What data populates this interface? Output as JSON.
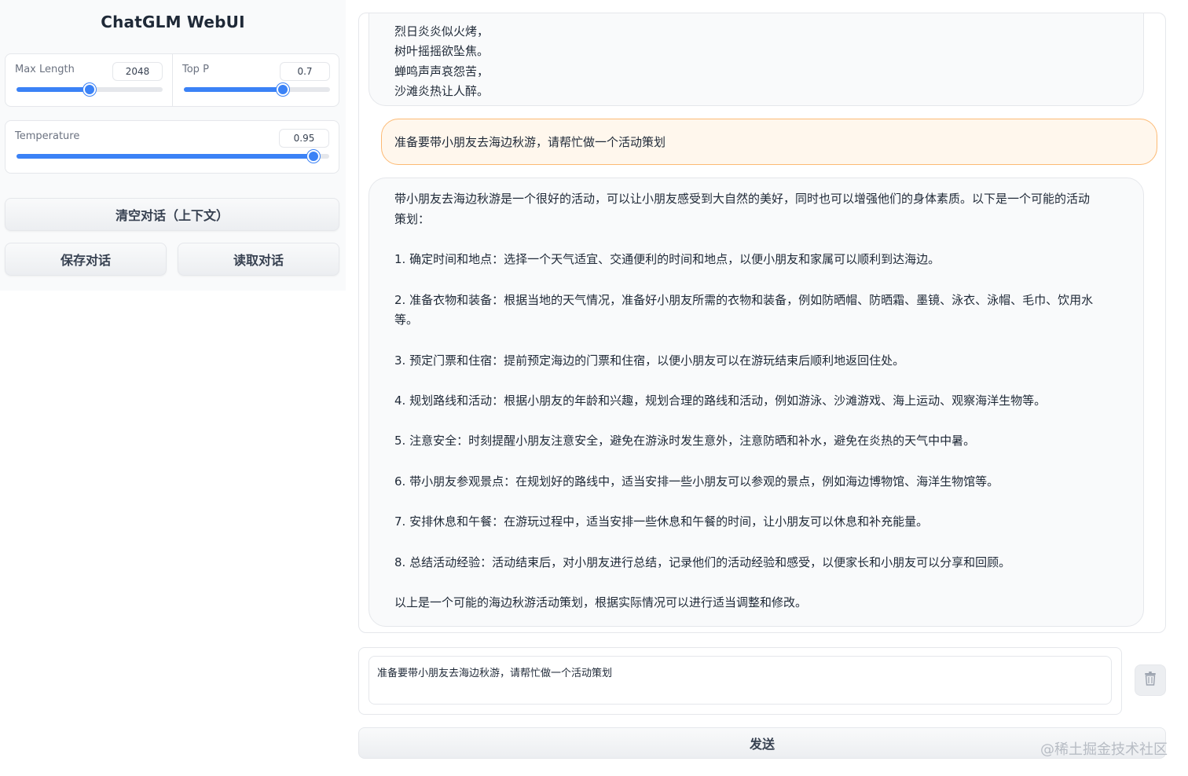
{
  "app": {
    "title": "ChatGLM WebUI"
  },
  "params": {
    "max_length": {
      "label": "Max Length",
      "value": "2048",
      "fraction": 0.5
    },
    "top_p": {
      "label": "Top P",
      "value": "0.7",
      "fraction": 0.68
    },
    "temperature": {
      "label": "Temperature",
      "value": "0.95",
      "fraction": 0.95
    }
  },
  "buttons": {
    "clear": "清空对话（上下文）",
    "save": "保存对话",
    "load": "读取对话",
    "send": "发送"
  },
  "chat": {
    "poem_lines": [
      "烈日炎炎似火烤，",
      "树叶摇摇欲坠焦。",
      "蝉鸣声声哀怨苦，",
      "沙滩炎热让人醉。"
    ],
    "user_message": "准备要带小朋友去海边秋游，请帮忙做一个活动策划",
    "bot_reply": {
      "intro_line1": "带小朋友去海边秋游是一个很好的活动，可以让小朋友感受到大自然的美好，同时也可以增强他们的身体素质。以下是一个可能的活动",
      "intro_line2": "策划：",
      "items": [
        {
          "l1": "1. 确定时间和地点：选择一个天气适宜、交通便利的时间和地点，以便小朋友和家属可以顺利到达海边。",
          "l2": ""
        },
        {
          "l1": "2. 准备衣物和装备：根据当地的天气情况，准备好小朋友所需的衣物和装备，例如防晒帽、防晒霜、墨镜、泳衣、泳帽、毛巾、饮用水",
          "l2": "等。"
        },
        {
          "l1": "3. 预定门票和住宿：提前预定海边的门票和住宿，以便小朋友可以在游玩结束后顺利地返回住处。",
          "l2": ""
        },
        {
          "l1": "4. 规划路线和活动：根据小朋友的年龄和兴趣，规划合理的路线和活动，例如游泳、沙滩游戏、海上运动、观察海洋生物等。",
          "l2": ""
        },
        {
          "l1": "5. 注意安全：时刻提醒小朋友注意安全，避免在游泳时发生意外，注意防晒和补水，避免在炎热的天气中中暑。",
          "l2": ""
        },
        {
          "l1": "6. 带小朋友参观景点：在规划好的路线中，适当安排一些小朋友可以参观的景点，例如海边博物馆、海洋生物馆等。",
          "l2": ""
        },
        {
          "l1": "7. 安排休息和午餐：在游玩过程中，适当安排一些休息和午餐的时间，让小朋友可以休息和补充能量。",
          "l2": ""
        },
        {
          "l1": "8. 总结活动经验：活动结束后，对小朋友进行总结，记录他们的活动经验和感受，以便家长和小朋友可以分享和回顾。",
          "l2": ""
        }
      ],
      "conclusion": "以上是一个可能的海边秋游活动策划，根据实际情况可以进行适当调整和修改。"
    }
  },
  "input": {
    "value": "准备要带小朋友去海边秋游，请帮忙做一个活动策划"
  },
  "icons": {
    "clear_input": "trash-icon"
  },
  "watermark": "@稀土掘金技术社区",
  "colors": {
    "accent": "#3b82f6",
    "user_bubble": "#fff7ed",
    "user_border": "#fdba74"
  }
}
